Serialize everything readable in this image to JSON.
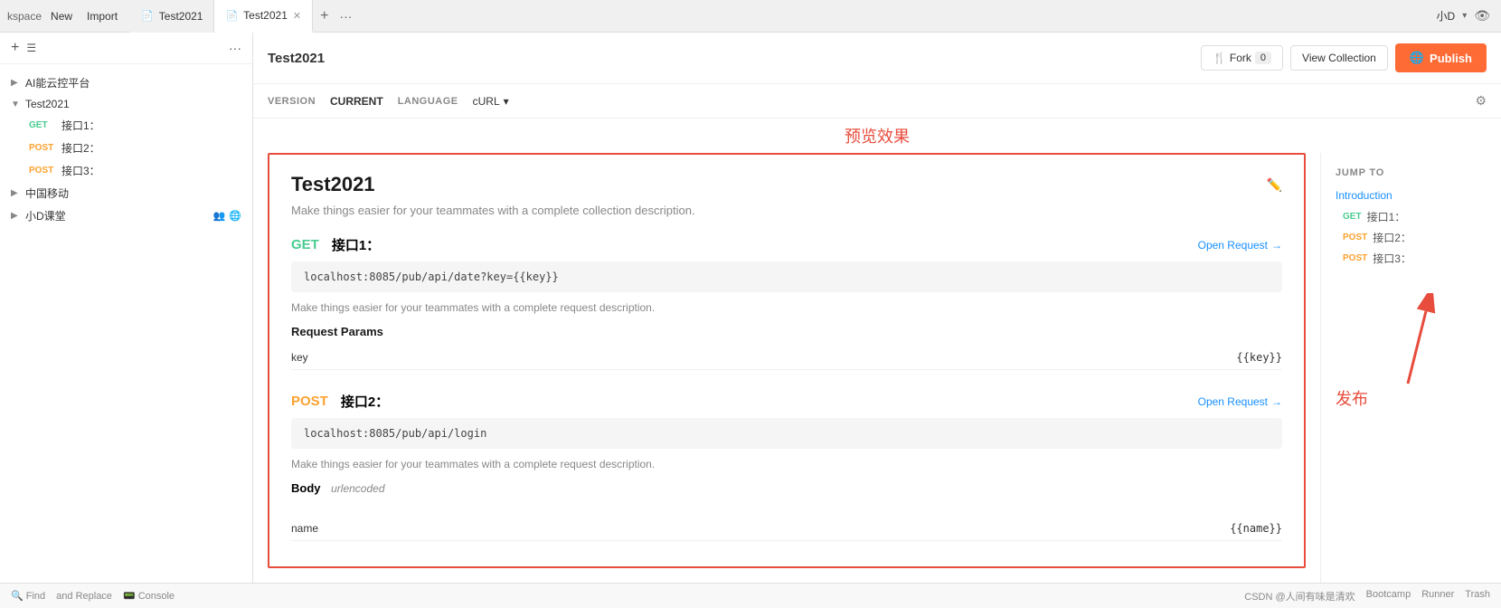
{
  "tabbar": {
    "workspace": "kspace",
    "new_label": "New",
    "import_label": "Import",
    "tabs": [
      {
        "id": "tab1",
        "icon": "📄",
        "label": "Test2021",
        "active": false
      },
      {
        "id": "tab2",
        "icon": "📄",
        "label": "Test2021",
        "active": true
      }
    ],
    "user": "小D",
    "add_label": "+",
    "more_label": "···"
  },
  "sidebar": {
    "add_icon": "+",
    "list_icon": "☰",
    "more_icon": "···",
    "items": [
      {
        "type": "group",
        "label": "AI能云控平台",
        "expanded": false,
        "indent": 0
      },
      {
        "type": "group",
        "label": "Test2021",
        "expanded": true,
        "indent": 0
      },
      {
        "type": "endpoint",
        "method": "GET",
        "label": "接口1：",
        "indent": 1
      },
      {
        "type": "endpoint",
        "method": "POST",
        "label": "接口2：",
        "indent": 1
      },
      {
        "type": "endpoint",
        "method": "POST",
        "label": "接口3：",
        "indent": 1
      },
      {
        "type": "group",
        "label": "中国移动",
        "expanded": false,
        "indent": 0
      },
      {
        "type": "group",
        "label": "小D课堂",
        "expanded": false,
        "indent": 0,
        "icons": [
          "👥",
          "🌐"
        ]
      }
    ]
  },
  "header": {
    "title": "Test2021",
    "fork_label": "🍴 Fork",
    "fork_count": "0",
    "view_collection_label": "View Collection",
    "publish_label": "Publish"
  },
  "version_bar": {
    "version_key": "VERSION",
    "version_value": "CURRENT",
    "language_key": "LANGUAGE",
    "language_value": "cURL",
    "gear_icon": "⚙"
  },
  "preview_annotation": "预览效果",
  "publish_annotation": "发布",
  "preview": {
    "title": "Test2021",
    "description": "Make things easier for your teammates with a complete collection description.",
    "endpoints": [
      {
        "method": "GET",
        "name": "接口1：",
        "open_request": "Open Request",
        "url": "localhost:8085/pub/api/date?key={{key}}",
        "description": "Make things easier for your teammates with a complete request description.",
        "params_title": "Request Params",
        "params": [
          {
            "key": "key",
            "value": "{{key}}"
          }
        ]
      },
      {
        "method": "POST",
        "name": "接口2：",
        "open_request": "Open Request",
        "url": "localhost:8085/pub/api/login",
        "description": "Make things easier for your teammates with a complete request description.",
        "body_title": "Body",
        "body_encoding": "urlencoded",
        "params": [
          {
            "key": "name",
            "value": "{{name}}"
          }
        ]
      }
    ]
  },
  "jump_to": {
    "title": "JUMP TO",
    "intro": "Introduction",
    "items": [
      {
        "method": "GET",
        "label": "接口1："
      },
      {
        "method": "POST",
        "label": "接口2："
      },
      {
        "method": "POST",
        "label": "接口3："
      }
    ]
  },
  "bottom_bar": {
    "find_replace": "and Replace",
    "console": "Console",
    "bootcamp": "Bootcamp",
    "runner": "Runner",
    "trash": "Trash",
    "csdn_label": "CSDN @人间有味是清欢"
  }
}
